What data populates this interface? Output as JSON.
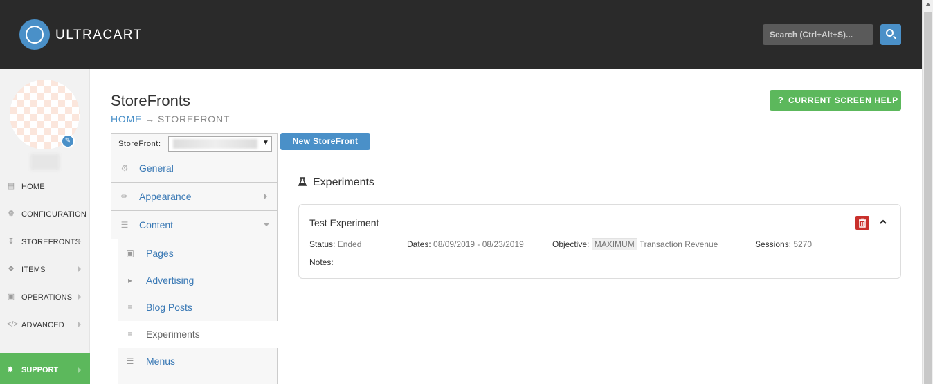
{
  "header": {
    "brand": "ULTRACART",
    "search_placeholder": "Search (Ctrl+Alt+S)..."
  },
  "sidebar": {
    "items": [
      {
        "label": "HOME",
        "icon": "bar-chart-icon",
        "has_submenu": false
      },
      {
        "label": "CONFIGURATION",
        "icon": "gear-icon",
        "has_submenu": false
      },
      {
        "label": "STOREFRONTS",
        "icon": "cart-icon",
        "has_submenu": true
      },
      {
        "label": "ITEMS",
        "icon": "tags-icon",
        "has_submenu": true
      },
      {
        "label": "OPERATIONS",
        "icon": "briefcase-icon",
        "has_submenu": true
      },
      {
        "label": "ADVANCED",
        "icon": "code-icon",
        "has_submenu": true
      }
    ],
    "support_label": "SUPPORT"
  },
  "page": {
    "title": "StoreFronts",
    "breadcrumb_home": "HOME",
    "breadcrumb_sep": "→",
    "breadcrumb_current": "STOREFRONT",
    "help_label": "CURRENT SCREEN HELP",
    "help_icon": "?"
  },
  "storefront_select": {
    "label": "StoreFront:",
    "new_button": "New StoreFront"
  },
  "content_menu": {
    "items": [
      {
        "label": "General",
        "icon": "gear-icon"
      },
      {
        "label": "Appearance",
        "icon": "brush-icon"
      },
      {
        "label": "Content",
        "icon": "list-icon"
      }
    ],
    "sub_items": [
      {
        "label": "Pages",
        "icon": "page-icon"
      },
      {
        "label": "Advertising",
        "icon": "megaphone-icon"
      },
      {
        "label": "Blog Posts",
        "icon": "lines-icon"
      },
      {
        "label": "Experiments",
        "icon": "lines-icon",
        "active": true
      },
      {
        "label": "Menus",
        "icon": "menu-icon"
      }
    ]
  },
  "experiments": {
    "section_title": "Experiments",
    "card": {
      "name": "Test Experiment",
      "status_label": "Status:",
      "status_value": "Ended",
      "dates_label": "Dates:",
      "dates_value": "08/09/2019 - 08/23/2019",
      "objective_label": "Objective:",
      "objective_tag": "MAXIMUM",
      "objective_value": "Transaction Revenue",
      "sessions_label": "Sessions:",
      "sessions_value": "5270",
      "notes_label": "Notes:"
    }
  },
  "colors": {
    "header_bg": "#2a2a2a",
    "accent_blue": "#4a90c8",
    "success_green": "#5cb85c",
    "danger_red": "#c9302c"
  }
}
